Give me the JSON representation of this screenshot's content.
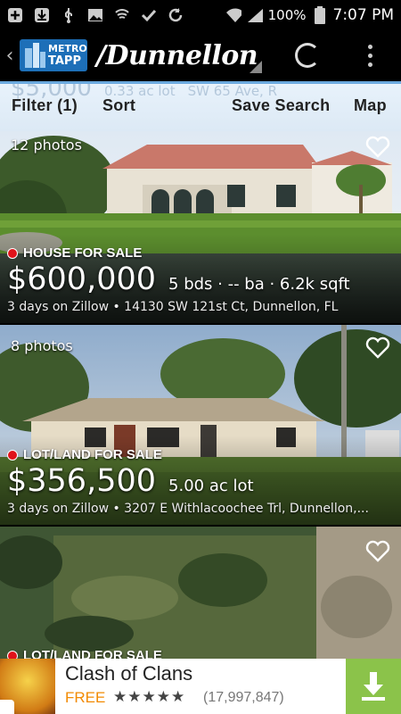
{
  "status_bar": {
    "battery_percent": "100%",
    "time": "7:07 PM",
    "icons": [
      "add-icon",
      "download-icon",
      "usb-icon",
      "image-icon",
      "shield-icon",
      "check-icon",
      "sync-icon",
      "wifi-icon",
      "signal-icon",
      "battery-icon"
    ]
  },
  "app_bar": {
    "logo_line1": "METRO",
    "logo_line2": "TAPP",
    "city": "/Dunnellon"
  },
  "toolbar": {
    "ghost_price": "$5,000",
    "ghost_detail": "0.33 ac lot",
    "ghost_address": "SW 65 Ave, R",
    "filter_label": "Filter (1)",
    "sort_label": "Sort",
    "save_search_label": "Save Search",
    "map_label": "Map"
  },
  "listings": [
    {
      "photos": "12 photos",
      "status": "HOUSE FOR SALE",
      "price": "$600,000",
      "details": "5 bds · -- ba · 6.2k sqft",
      "subline": "3 days on Zillow • 14130 SW 121st Ct, Dunnellon, FL"
    },
    {
      "photos": "8 photos",
      "status": "LOT/LAND FOR SALE",
      "price": "$356,500",
      "details": "5.00 ac lot",
      "subline": "3 days on Zillow • 3207 E Withlacoochee Trl, Dunnellon,..."
    },
    {
      "status": "LOT/LAND FOR SALE"
    }
  ],
  "ad": {
    "title": "Clash of Clans",
    "price": "FREE",
    "stars": "★★★★★",
    "rating_count": "(17,997,847)"
  },
  "colors": {
    "toolbar_bg": "#dce9f5",
    "status_dot": "#e0131a",
    "ad_download": "#8bc34a",
    "ad_free": "#f28a00"
  }
}
